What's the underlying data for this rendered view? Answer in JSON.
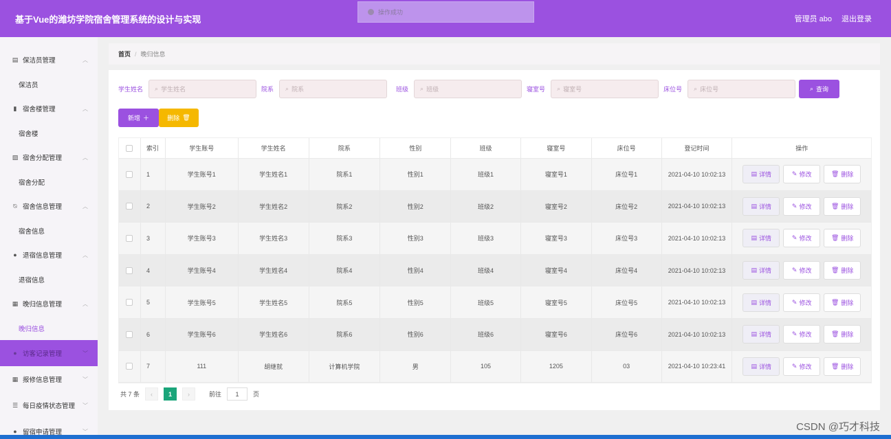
{
  "header": {
    "title": "基于Vue的潍坊学院宿舍管理系统的设计与实现",
    "user": "管理员 abo",
    "logout": "退出登录"
  },
  "toast": {
    "text": "操作成功"
  },
  "sidebar": {
    "groups": [
      {
        "label": "保洁员管理",
        "icon": "clipboard-icon",
        "sub": "保洁员"
      },
      {
        "label": "宿舍楼管理",
        "icon": "bar-chart-icon",
        "sub": "宿舍楼"
      },
      {
        "label": "宿舍分配管理",
        "icon": "chart-box-icon",
        "sub": "宿舍分配"
      },
      {
        "label": "宿舍信息管理",
        "icon": "slash-bell-icon",
        "sub": "宿舍信息"
      },
      {
        "label": "退宿信息管理",
        "icon": "bulb-icon",
        "sub": "退宿信息"
      },
      {
        "label": "晚归信息管理",
        "icon": "grid-icon",
        "sub": "晚归信息"
      }
    ],
    "collapsed": [
      {
        "label": "访客记录管理",
        "icon": "circle-icon"
      },
      {
        "label": "报修信息管理",
        "icon": "grid9-icon"
      },
      {
        "label": "每日疫情状态管理",
        "icon": "menu-icon"
      },
      {
        "label": "留宿申请管理",
        "icon": "person-icon"
      }
    ]
  },
  "breadcrumb": {
    "home": "首页",
    "separator": "/",
    "current": "晚归信息"
  },
  "search": {
    "fields": [
      {
        "label": "学生姓名",
        "placeholder": "学生姓名"
      },
      {
        "label": "院系",
        "placeholder": "院系"
      },
      {
        "label": "班级",
        "placeholder": "班级"
      },
      {
        "label": "寝室号",
        "placeholder": "寝室号"
      },
      {
        "label": "床位号",
        "placeholder": "床位号"
      }
    ],
    "query_label": "查询"
  },
  "actions": {
    "add": "新增",
    "delete": "删除"
  },
  "table": {
    "headers": [
      "索引",
      "学生账号",
      "学生姓名",
      "院系",
      "性别",
      "班级",
      "寝室号",
      "床位号",
      "登记时间",
      "操作"
    ],
    "row_actions": {
      "detail": "详情",
      "edit": "修改",
      "delete": "删除"
    },
    "rows": [
      {
        "idx": "1",
        "account": "学生账号1",
        "name": "学生姓名1",
        "dept": "院系1",
        "gender": "性别1",
        "class": "班级1",
        "room": "寝室号1",
        "bed": "床位号1",
        "time": "2021-04-10 10:02:13"
      },
      {
        "idx": "2",
        "account": "学生账号2",
        "name": "学生姓名2",
        "dept": "院系2",
        "gender": "性别2",
        "class": "班级2",
        "room": "寝室号2",
        "bed": "床位号2",
        "time": "2021-04-10 10:02:13"
      },
      {
        "idx": "3",
        "account": "学生账号3",
        "name": "学生姓名3",
        "dept": "院系3",
        "gender": "性别3",
        "class": "班级3",
        "room": "寝室号3",
        "bed": "床位号3",
        "time": "2021-04-10 10:02:13"
      },
      {
        "idx": "4",
        "account": "学生账号4",
        "name": "学生姓名4",
        "dept": "院系4",
        "gender": "性别4",
        "class": "班级4",
        "room": "寝室号4",
        "bed": "床位号4",
        "time": "2021-04-10 10:02:13"
      },
      {
        "idx": "5",
        "account": "学生账号5",
        "name": "学生姓名5",
        "dept": "院系5",
        "gender": "性别5",
        "class": "班级5",
        "room": "寝室号5",
        "bed": "床位号5",
        "time": "2021-04-10 10:02:13"
      },
      {
        "idx": "6",
        "account": "学生账号6",
        "name": "学生姓名6",
        "dept": "院系6",
        "gender": "性别6",
        "class": "班级6",
        "room": "寝室号6",
        "bed": "床位号6",
        "time": "2021-04-10 10:02:13"
      },
      {
        "idx": "7",
        "account": "111",
        "name": "胡继就",
        "dept": "计算机学院",
        "gender": "男",
        "class": "105",
        "room": "1205",
        "bed": "03",
        "time": "2021-04-10 10:23:41"
      }
    ]
  },
  "pagination": {
    "total": "共 7 条",
    "current": "1",
    "goto": "前往",
    "page_value": "1",
    "page_unit": "页"
  },
  "watermark": "CSDN @巧才科技",
  "colors": {
    "primary": "#9b51e0",
    "warning": "#f5b800",
    "page_active": "#1aa57a"
  }
}
